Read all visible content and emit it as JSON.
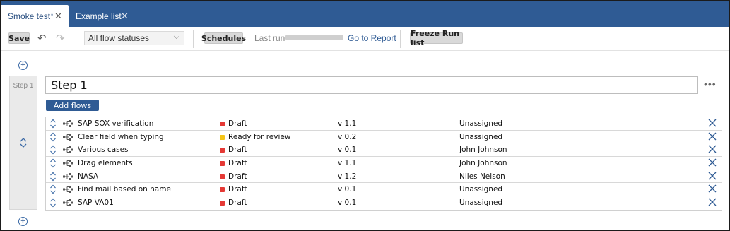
{
  "tabs": [
    {
      "label": "Smoke test",
      "dirty_marker": "*",
      "active": true
    },
    {
      "label": "Example list",
      "dirty_marker": "",
      "active": false
    }
  ],
  "toolbar": {
    "save_label": "Save",
    "status_filter": "All flow statuses",
    "schedules_label": "Schedules",
    "last_run_label": "Last run",
    "go_to_report_label": "Go to Report",
    "freeze_label": "Freeze Run list"
  },
  "step": {
    "rail_label": "Step 1",
    "title": "Step 1",
    "more_label": "•••",
    "add_flows_label": "Add flows"
  },
  "colors": {
    "brand": "#2f5b94",
    "status_draft": "#e53935",
    "status_review": "#f5c518",
    "remove_icon": "#2f5b94"
  },
  "flows": [
    {
      "name": "SAP SOX verification",
      "status": "Draft",
      "status_color": "#e53935",
      "version": "v 1.1",
      "assignee": "Unassigned"
    },
    {
      "name": "Clear field when typing",
      "status": "Ready for review",
      "status_color": "#f5c518",
      "version": "v 0.2",
      "assignee": "Unassigned"
    },
    {
      "name": "Various cases",
      "status": "Draft",
      "status_color": "#e53935",
      "version": "v 0.1",
      "assignee": "John Johnson"
    },
    {
      "name": "Drag elements",
      "status": "Draft",
      "status_color": "#e53935",
      "version": "v 1.1",
      "assignee": "John Johnson"
    },
    {
      "name": "NASA",
      "status": "Draft",
      "status_color": "#e53935",
      "version": "v 1.2",
      "assignee": "Niles Nelson"
    },
    {
      "name": "Find mail based on name",
      "status": "Draft",
      "status_color": "#e53935",
      "version": "v 0.1",
      "assignee": "Unassigned"
    },
    {
      "name": "SAP VA01",
      "status": "Draft",
      "status_color": "#e53935",
      "version": "v 0.1",
      "assignee": "Unassigned"
    }
  ]
}
